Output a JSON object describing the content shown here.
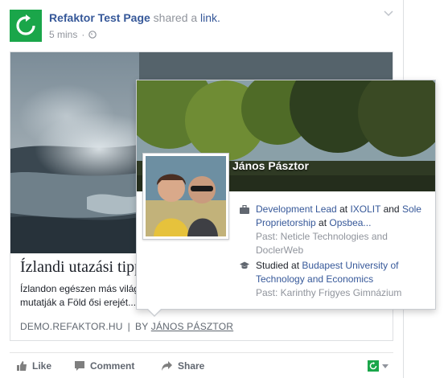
{
  "post": {
    "page_name": "Refaktor Test Page",
    "action_text": "shared a",
    "link_word": "link.",
    "time": "5 mins",
    "time_separator": "·"
  },
  "card": {
    "title": "Ízlandi utazási tipp",
    "description": "Ízlandon egészen más világ mutatják a Föld ősi erejét...",
    "domain": "DEMO.REFAKTOR.HU",
    "separator": "|",
    "by_label": "BY",
    "author": "JÁNOS PÁSZTOR"
  },
  "actions": {
    "like": "Like",
    "comment": "Comment",
    "share": "Share"
  },
  "hovercard": {
    "name": "János Pásztor",
    "work": {
      "role": "Development Lead",
      "at1": "at",
      "company1": "IXOLIT",
      "and": "and",
      "role2": "Sole Proprietorship",
      "at2": "at",
      "company2": "Opsbea...",
      "past": "Past: Neticle Technologies and DoclerWeb"
    },
    "education": {
      "studied_at": "Studied at",
      "school": "Budapest University of Technology and Economics",
      "past": "Past: Karinthy Frigyes Gimnázium"
    }
  },
  "colors": {
    "brand_green": "#1aa64a",
    "link_blue": "#365899",
    "muted_gray": "#90949c"
  },
  "icons": [
    "refaktor-logo-icon",
    "chevron-down-icon",
    "globe-icon",
    "like-icon",
    "comment-icon",
    "share-icon",
    "briefcase-icon",
    "graduation-cap-icon"
  ]
}
